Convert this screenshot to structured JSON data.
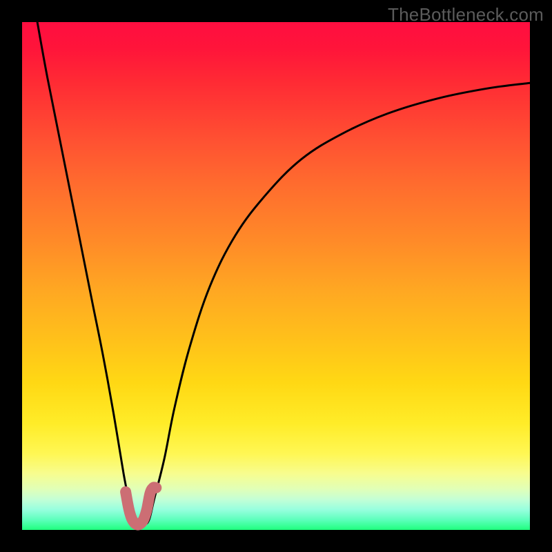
{
  "watermark": "TheBottleneck.com",
  "chart_data": {
    "type": "line",
    "title": "",
    "xlabel": "",
    "ylabel": "",
    "xlim": [
      0,
      100
    ],
    "ylim": [
      0,
      100
    ],
    "grid": false,
    "series": [
      {
        "name": "curve",
        "color": "#000000",
        "x": [
          3,
          5,
          8,
          11,
          14,
          16,
          18,
          20,
          21,
          22,
          23,
          24,
          25,
          26,
          28,
          30,
          33,
          37,
          42,
          48,
          55,
          63,
          72,
          82,
          92,
          100
        ],
        "y": [
          100,
          89,
          74,
          59,
          44,
          34,
          23,
          11,
          6,
          2,
          1,
          1,
          2,
          6,
          14,
          24,
          36,
          48,
          58,
          66,
          73,
          78,
          82,
          85,
          87,
          88
        ]
      },
      {
        "name": "highlight",
        "color": "#cc6e74",
        "x": [
          20.4,
          21.0,
          21.6,
          22.2,
          22.8,
          23.4,
          24.0,
          24.6,
          25.2,
          25.8,
          26.4
        ],
        "y": [
          7.5,
          4.2,
          2.2,
          1.3,
          1.0,
          1.3,
          2.2,
          4.2,
          7.2,
          8.3,
          8.3
        ]
      }
    ],
    "annotations": []
  }
}
